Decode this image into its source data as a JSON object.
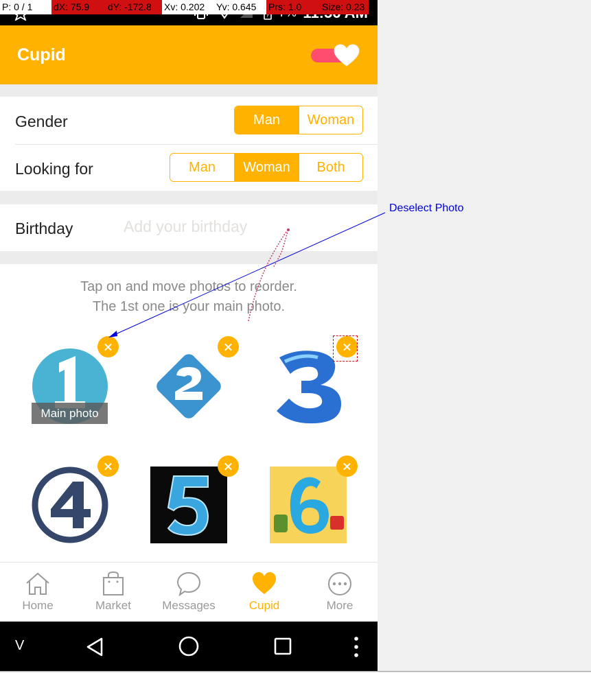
{
  "debug_bar": {
    "pointer": "P: 0 / 1",
    "dx": "dX: 75.9",
    "dy": "dY: -172.8",
    "xv": "Xv: 0.202",
    "yv": "Yv: 0.645",
    "prs": "Prs: 1.0",
    "size": "Size: 0.23"
  },
  "status_bar": {
    "time": "11:56 AM",
    "battery_pct": "7%"
  },
  "app_bar": {
    "title": "Cupid",
    "toggle_on": true
  },
  "gender": {
    "label": "Gender",
    "options": [
      "Man",
      "Woman"
    ],
    "selected": "Man"
  },
  "looking_for": {
    "label": "Looking for",
    "options": [
      "Man",
      "Woman",
      "Both"
    ],
    "selected": "Woman"
  },
  "birthday": {
    "label": "Birthday",
    "placeholder": "Add your birthday",
    "value": ""
  },
  "photos": {
    "hint_line1": "Tap on and move photos to reorder.",
    "hint_line2": "The 1st one is your main photo.",
    "main_badge": "Main photo",
    "items": [
      "1",
      "2",
      "3",
      "4",
      "5",
      "6"
    ]
  },
  "bottom_nav": {
    "items": [
      {
        "label": "Home",
        "icon": "home-icon"
      },
      {
        "label": "Market",
        "icon": "bag-icon"
      },
      {
        "label": "Messages",
        "icon": "chat-bubble-icon"
      },
      {
        "label": "Cupid",
        "icon": "heart-icon"
      },
      {
        "label": "More",
        "icon": "more-dots-icon"
      }
    ],
    "active": "Cupid"
  },
  "system_nav": {
    "v_label": "V"
  },
  "annotation": {
    "label": "Deselect Photo"
  },
  "colors": {
    "accent": "#ffb300",
    "toggle": "#ff4d6d",
    "annotation": "#0000dd"
  }
}
